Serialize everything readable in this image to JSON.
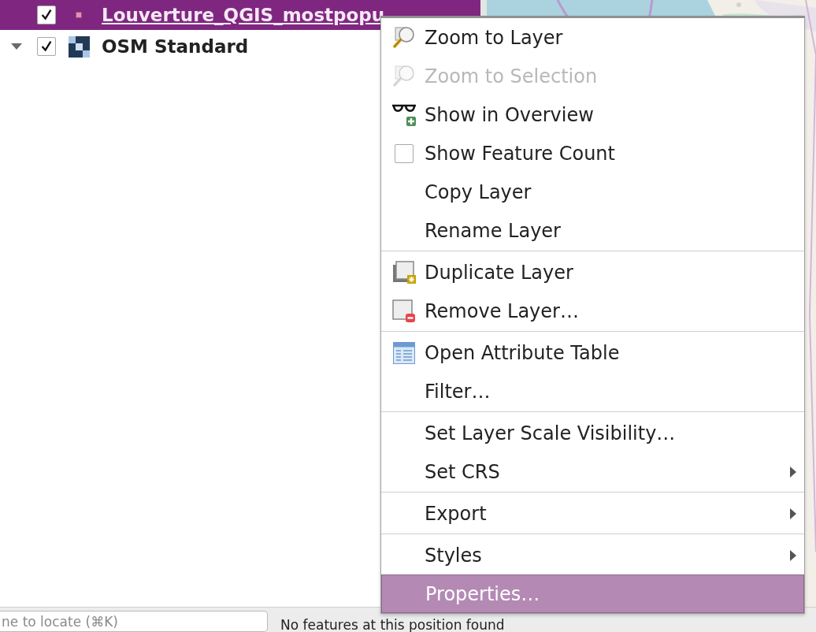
{
  "layers": [
    {
      "name": "Louverture_QGIS_mostpopu",
      "kind": "point",
      "checked": true,
      "selected": true,
      "expandable": false
    },
    {
      "name": "OSM Standard",
      "kind": "raster",
      "checked": true,
      "selected": false,
      "expandable": true
    }
  ],
  "context_menu": {
    "sections": [
      [
        {
          "label": "Zoom to Layer",
          "kind": "zoom",
          "disabled": false,
          "submenu": false,
          "selected": false
        },
        {
          "label": "Zoom to Selection",
          "kind": "zoom",
          "disabled": true,
          "submenu": false,
          "selected": false
        },
        {
          "label": "Show in Overview",
          "kind": "overview",
          "disabled": false,
          "submenu": false,
          "selected": false
        },
        {
          "label": "Show Feature Count",
          "kind": "checkbox",
          "checked": false,
          "disabled": false,
          "submenu": false,
          "selected": false
        },
        {
          "label": "Copy Layer",
          "kind": "plain",
          "disabled": false,
          "submenu": false,
          "selected": false
        },
        {
          "label": "Rename Layer",
          "kind": "plain",
          "disabled": false,
          "submenu": false,
          "selected": false
        }
      ],
      [
        {
          "label": "Duplicate Layer",
          "kind": "duplicate",
          "disabled": false,
          "submenu": false,
          "selected": false
        },
        {
          "label": "Remove Layer…",
          "kind": "remove",
          "disabled": false,
          "submenu": false,
          "selected": false
        }
      ],
      [
        {
          "label": "Open Attribute Table",
          "kind": "table",
          "disabled": false,
          "submenu": false,
          "selected": false
        },
        {
          "label": "Filter…",
          "kind": "plain",
          "disabled": false,
          "submenu": false,
          "selected": false
        }
      ],
      [
        {
          "label": "Set Layer Scale Visibility…",
          "kind": "plain",
          "disabled": false,
          "submenu": false,
          "selected": false
        },
        {
          "label": "Set CRS",
          "kind": "plain",
          "disabled": false,
          "submenu": true,
          "selected": false
        }
      ],
      [
        {
          "label": "Export",
          "kind": "plain",
          "disabled": false,
          "submenu": true,
          "selected": false
        }
      ],
      [
        {
          "label": "Styles",
          "kind": "plain",
          "disabled": false,
          "submenu": true,
          "selected": false
        },
        {
          "label": "Properties…",
          "kind": "plain",
          "disabled": false,
          "submenu": false,
          "selected": true
        }
      ]
    ]
  },
  "status_bar": {
    "locator": {
      "placeholder": "ne to locate (⌘K)"
    },
    "message": "No features at this position found"
  }
}
